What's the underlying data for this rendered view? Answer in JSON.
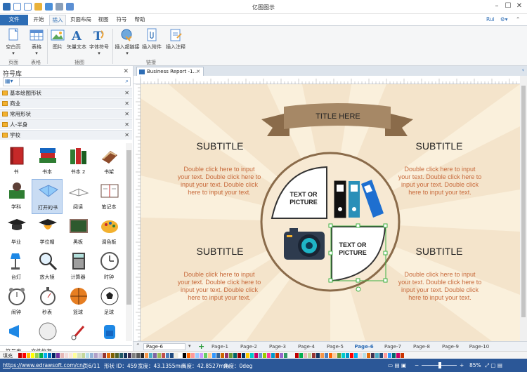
{
  "window": {
    "title": "亿图图示",
    "user": "Rui"
  },
  "menu_tabs": [
    "文件",
    "开始",
    "插入",
    "页面布局",
    "视图",
    "符号",
    "帮助"
  ],
  "ribbon": {
    "blank_page": "空白页",
    "table": "表格",
    "picture": "图片",
    "vector_text": "矢量文本",
    "font_symbol": "字体符号",
    "insert_hyperlink": "插入超链接",
    "insert_attachment": "插入附件",
    "insert_note": "插入注释",
    "groups": {
      "page": "页面",
      "table": "表格",
      "illustration": "插图",
      "link": "链接"
    }
  },
  "library": {
    "title": "符号库",
    "categories": [
      "基本绘图形状",
      "商业",
      "常用形状",
      "人-半身",
      "学校"
    ],
    "symbols": [
      {
        "label": "书",
        "icon": "red-book-icon"
      },
      {
        "label": "书本",
        "icon": "book-stack-icon"
      },
      {
        "label": "书本 2",
        "icon": "book-stack-2-icon"
      },
      {
        "label": "书架",
        "icon": "bookshelf-icon"
      },
      {
        "label": "学科",
        "icon": "subject-icon"
      },
      {
        "label": "打开的书",
        "icon": "open-book-icon"
      },
      {
        "label": "阅读",
        "icon": "reading-icon"
      },
      {
        "label": "笔记本",
        "icon": "notebook-icon"
      },
      {
        "label": "毕业",
        "icon": "graduation-icon"
      },
      {
        "label": "学位帽",
        "icon": "mortarboard-icon"
      },
      {
        "label": "黑板",
        "icon": "blackboard-icon"
      },
      {
        "label": "调色板",
        "icon": "palette-icon"
      },
      {
        "label": "台灯",
        "icon": "desk-lamp-icon"
      },
      {
        "label": "放大镜",
        "icon": "magnifier-icon"
      },
      {
        "label": "计算器",
        "icon": "calculator-icon"
      },
      {
        "label": "时钟",
        "icon": "clock-icon"
      },
      {
        "label": "闹钟",
        "icon": "alarm-clock-icon"
      },
      {
        "label": "秒表",
        "icon": "stopwatch-icon"
      },
      {
        "label": "篮球",
        "icon": "basketball-icon"
      },
      {
        "label": "足球",
        "icon": "soccer-ball-icon"
      }
    ],
    "bottom_tabs": [
      "符号库",
      "文件恢复"
    ]
  },
  "document": {
    "tab_title": "Business Report -1...",
    "title_here": "TITLE HERE",
    "subtitles": [
      "SUBTITLE",
      "SUBTITLE",
      "SUBTITLE",
      "SUBTITLE"
    ],
    "body_text": "Double click here to input your text. Double click here to input your text. Double click here to input your text.",
    "box_text": "TEXT OR PICTURE"
  },
  "pages": {
    "current": "Page-6",
    "tabs": [
      "Page-1",
      "Page-2",
      "Page-3",
      "Page-4",
      "Page-5",
      "Page-6",
      "Page-7",
      "Page-8",
      "Page-9",
      "Page-10"
    ],
    "active_index": 5
  },
  "palette": {
    "label": "填充",
    "colors": [
      "#c00000",
      "#ff0000",
      "#ffc000",
      "#ffff00",
      "#92d050",
      "#00b050",
      "#00b0f0",
      "#0070c0",
      "#002060",
      "#7030a0",
      "#e6b8b7",
      "#f2dcdb",
      "#fde9d9",
      "#ffff99",
      "#d8e4bc",
      "#c4d79b",
      "#b7dee8",
      "#95b3d7",
      "#b1a0c7",
      "#ccc0da",
      "#963634",
      "#e26b0a",
      "#7f6000",
      "#4f6228",
      "#215967",
      "#16365c",
      "#403151",
      "#808080",
      "#595959",
      "#262626",
      "#f79646",
      "#4bacc6",
      "#8064a2",
      "#9bbb59",
      "#c0504d",
      "#4f81bd",
      "#1f497d",
      "#eeece1",
      "#ffffff",
      "#000000",
      "#ff6600",
      "#ff9999",
      "#99ccff",
      "#cc99ff",
      "#66cc66",
      "#ffcc99",
      "#3399ff",
      "#336699",
      "#cc6600",
      "#993366",
      "#669933",
      "#006666",
      "#990000",
      "#003366",
      "#ffcc00",
      "#00cccc",
      "#cc0066",
      "#6699cc",
      "#99cc00",
      "#ff3399",
      "#0099cc",
      "#cc3300",
      "#9966cc",
      "#339966"
    ]
  },
  "status": {
    "url": "https://www.edrawsoft.com/cn/",
    "page": "页6/11",
    "shape_id": "形状 ID：459",
    "width": "宽度：43.1355mm",
    "height": "高度：42.8527mm",
    "angle": "角度：0deg",
    "zoom": "85%"
  }
}
